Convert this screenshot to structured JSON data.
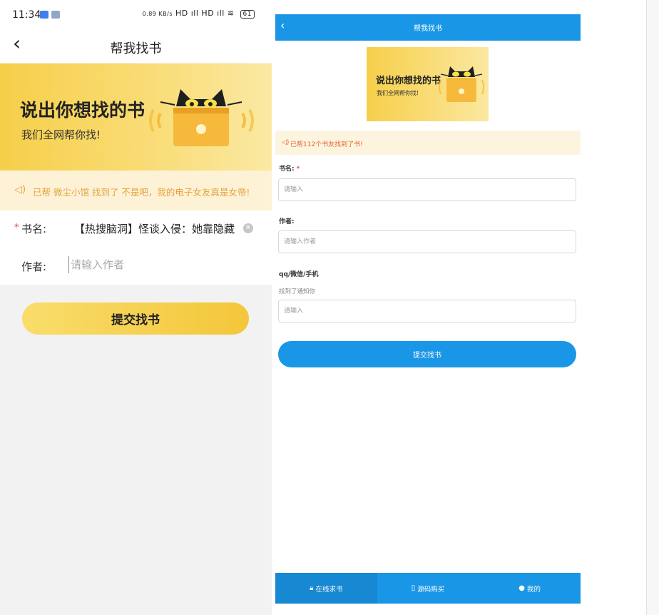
{
  "mobile": {
    "status": {
      "time": "11:34",
      "net_speed": "0.89 KB/s",
      "signal": "HD ıll HD ıll",
      "battery": "61"
    },
    "nav": {
      "back_glyph": "‹",
      "title": "帮我找书"
    },
    "banner": {
      "title": "说出你想找的书",
      "subtitle": "我们全网帮你找!"
    },
    "notice": {
      "icon": "speaker-icon",
      "text": "已帮 微尘小馆 找到了 不是吧，我的电子女友真是女帝!"
    },
    "form": {
      "required_mark": "*",
      "name_label": "书名:",
      "name_value": "【热搜脑洞】怪谈入侵：她靠隐藏规",
      "clear_glyph": "✕",
      "author_label": "作者:",
      "author_placeholder": "请输入作者",
      "author_value": ""
    },
    "submit_label": "提交找书"
  },
  "web": {
    "nav": {
      "back_glyph": "‹",
      "title": "帮我找书"
    },
    "banner": {
      "title": "说出你想找的书",
      "subtitle": "我们全网帮你找!"
    },
    "notice": {
      "icon": "speaker-icon",
      "text": "已帮112个书友找到了书!"
    },
    "form": {
      "name_label": "书名:",
      "required_mark": "*",
      "name_placeholder": "请输入",
      "author_label": "作者:",
      "author_placeholder": "请输入作者",
      "contact_label": "qq/微信/手机",
      "contact_hint": "找到了通知你",
      "contact_placeholder": "请输入"
    },
    "submit_label": "提交找书",
    "tabs": [
      {
        "label": "在线求书",
        "icon": "lock-icon",
        "active": true
      },
      {
        "label": "源码购买",
        "icon": "bookmark-icon",
        "active": false
      },
      {
        "label": "我的",
        "icon": "user-icon",
        "active": false
      }
    ]
  },
  "colors": {
    "brand_yellow": "#f4c63a",
    "web_blue": "#1a96e6",
    "notice_orange": "#e6a23c",
    "required_red": "#e94b4b"
  }
}
